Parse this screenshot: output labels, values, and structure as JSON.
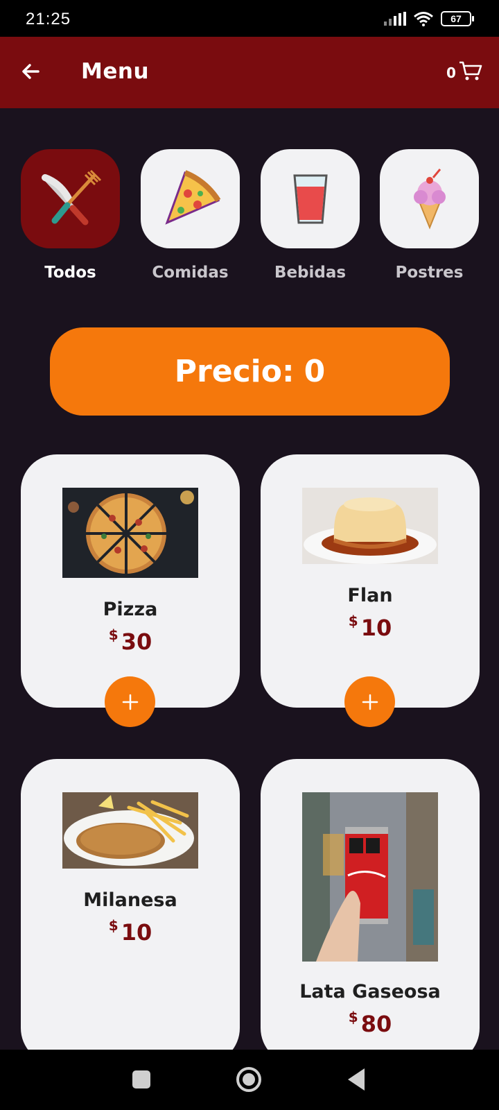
{
  "status": {
    "time": "21:25",
    "battery": "67"
  },
  "header": {
    "title": "Menu",
    "cart_count": "0"
  },
  "categories": [
    {
      "label": "Todos",
      "icon": "utensils-icon"
    },
    {
      "label": "Comidas",
      "icon": "pizza-slice-icon"
    },
    {
      "label": "Bebidas",
      "icon": "drink-glass-icon"
    },
    {
      "label": "Postres",
      "icon": "ice-cream-icon"
    }
  ],
  "price_bar": {
    "label": "Precio:",
    "value": "0"
  },
  "products": [
    {
      "name": "Pizza",
      "currency": "$",
      "price": "30"
    },
    {
      "name": "Flan",
      "currency": "$",
      "price": "10"
    },
    {
      "name": "Milanesa",
      "currency": "$",
      "price": "10"
    },
    {
      "name": "Lata Gaseosa",
      "currency": "$",
      "price": "80"
    }
  ],
  "colors": {
    "accent": "#f5780c",
    "brand": "#7a0c0f",
    "background": "#1a121e",
    "card": "#f2f2f4"
  }
}
